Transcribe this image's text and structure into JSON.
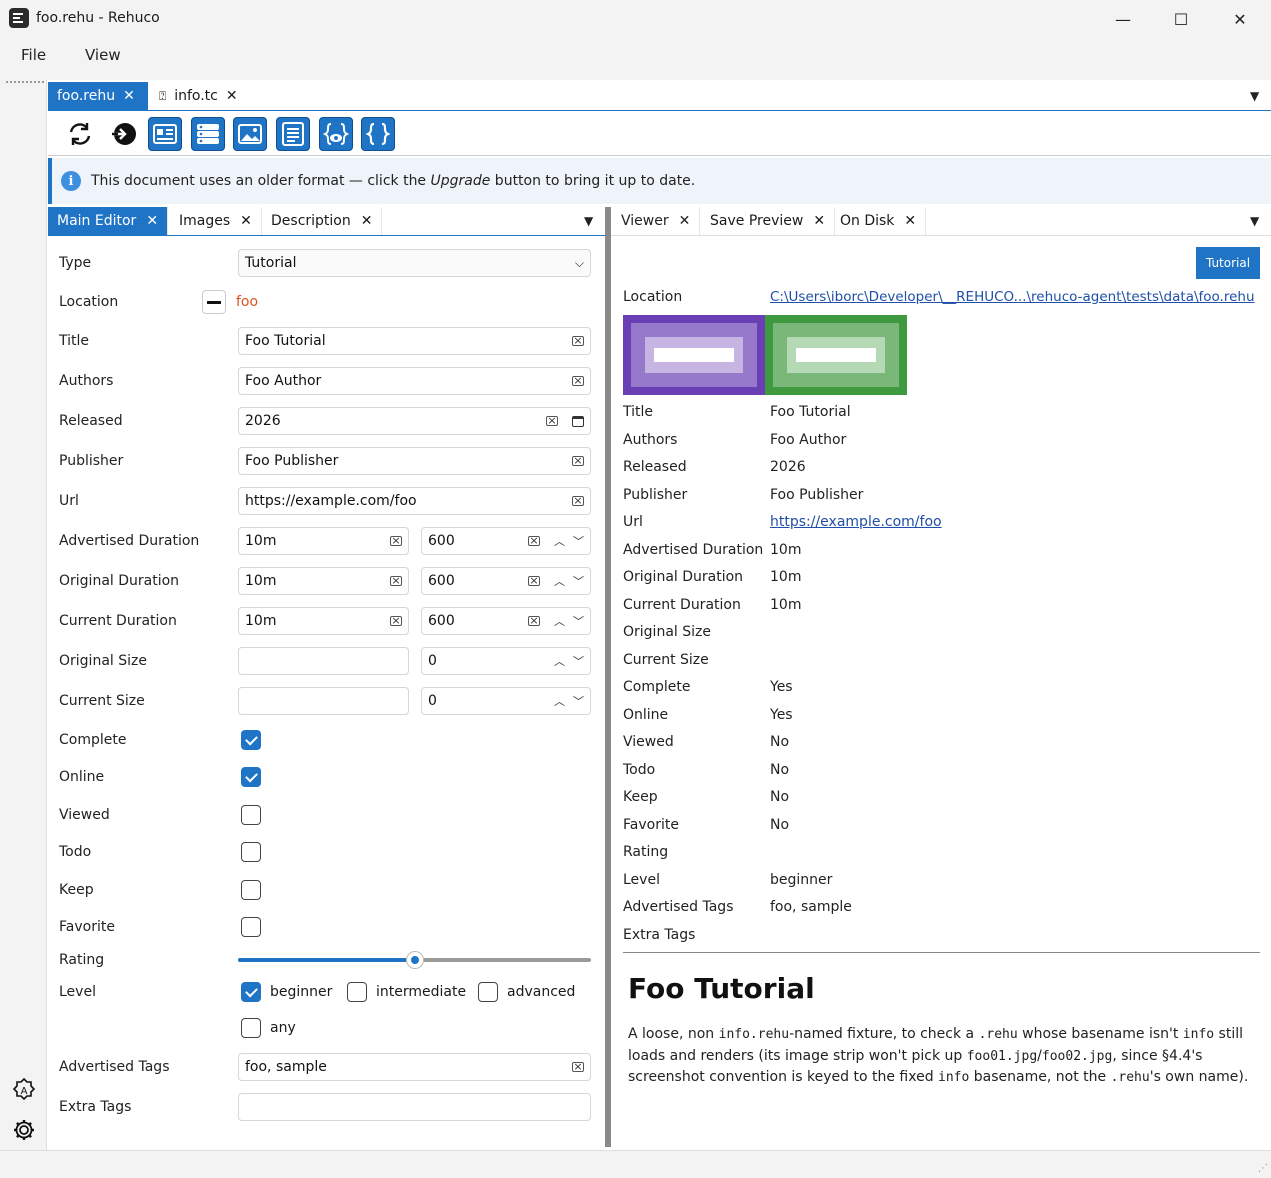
{
  "window": {
    "title": "foo.rehu - Rehuco",
    "min": "—",
    "max": "☐",
    "close": "✕"
  },
  "menu": [
    "File",
    "View"
  ],
  "doc_tabs": [
    {
      "label": "foo.rehu",
      "active": true
    },
    {
      "label": "info.tc",
      "active": false
    }
  ],
  "toolbar": {
    "icons": [
      "refresh-icon",
      "upgrade-icon",
      "card-view-icon",
      "list-view-icon",
      "image-view-icon",
      "text-view-icon",
      "json-preview-icon",
      "json-icon"
    ]
  },
  "info_bar": {
    "before": "This document uses an older format — click the ",
    "emph": "Upgrade",
    "after": " button to bring it up to date."
  },
  "left_tabs": [
    {
      "label": "Main Editor",
      "active": true
    },
    {
      "label": "Images"
    },
    {
      "label": "Description"
    }
  ],
  "right_tabs": [
    {
      "label": "Viewer",
      "active": true
    },
    {
      "label": "Save Preview"
    },
    {
      "label": "On Disk"
    }
  ],
  "editor": {
    "type_label": "Type",
    "type_value": "Tutorial",
    "location_label": "Location",
    "location_value": "foo",
    "title_label": "Title",
    "title_value": "Foo Tutorial",
    "authors_label": "Authors",
    "authors_value": "Foo Author",
    "released_label": "Released",
    "released_value": "2026",
    "publisher_label": "Publisher",
    "publisher_value": "Foo Publisher",
    "url_label": "Url",
    "url_value": "https://example.com/foo",
    "adv_dur_label": "Advertised Duration",
    "adv_dur_text": "10m",
    "adv_dur_num": "600",
    "orig_dur_label": "Original Duration",
    "orig_dur_text": "10m",
    "orig_dur_num": "600",
    "cur_dur_label": "Current Duration",
    "cur_dur_text": "10m",
    "cur_dur_num": "600",
    "orig_size_label": "Original Size",
    "orig_size_text": "",
    "orig_size_num": "0",
    "cur_size_label": "Current Size",
    "cur_size_text": "",
    "cur_size_num": "0",
    "complete_label": "Complete",
    "complete": true,
    "online_label": "Online",
    "online": true,
    "viewed_label": "Viewed",
    "viewed": false,
    "todo_label": "Todo",
    "todo": false,
    "keep_label": "Keep",
    "keep": false,
    "favorite_label": "Favorite",
    "favorite": false,
    "rating_label": "Rating",
    "rating_fraction": 0.5,
    "level_label": "Level",
    "levels": [
      {
        "label": "beginner",
        "checked": true
      },
      {
        "label": "intermediate",
        "checked": false
      },
      {
        "label": "advanced",
        "checked": false
      },
      {
        "label": "any",
        "checked": false
      }
    ],
    "adv_tags_label": "Advertised Tags",
    "adv_tags_value": "foo, sample",
    "extra_tags_label": "Extra Tags",
    "extra_tags_value": ""
  },
  "viewer": {
    "badge": "Tutorial",
    "location_label": "Location",
    "location_value": "C:\\Users\\iborc\\Developer\\__REHUCO...\\rehuco-agent\\tests\\data\\foo.rehu",
    "rows": [
      {
        "label": "Title",
        "value": "Foo Tutorial"
      },
      {
        "label": "Authors",
        "value": "Foo Author"
      },
      {
        "label": "Released",
        "value": "2026"
      },
      {
        "label": "Publisher",
        "value": "Foo Publisher"
      },
      {
        "label": "Url",
        "value": "https://example.com/foo",
        "link": true
      },
      {
        "label": "Advertised Duration",
        "value": "10m"
      },
      {
        "label": "Original Duration",
        "value": "10m"
      },
      {
        "label": "Current Duration",
        "value": "10m"
      },
      {
        "label": "Original Size",
        "value": ""
      },
      {
        "label": "Current Size",
        "value": ""
      },
      {
        "label": "Complete",
        "value": "Yes"
      },
      {
        "label": "Online",
        "value": "Yes"
      },
      {
        "label": "Viewed",
        "value": "No"
      },
      {
        "label": "Todo",
        "value": "No"
      },
      {
        "label": "Keep",
        "value": "No"
      },
      {
        "label": "Favorite",
        "value": "No"
      },
      {
        "label": "Rating",
        "value": ""
      },
      {
        "label": "Level",
        "value": "beginner"
      },
      {
        "label": "Advertised Tags",
        "value": "foo, sample"
      },
      {
        "label": "Extra Tags",
        "value": ""
      }
    ],
    "thumb_colors": [
      "#6a3fb5",
      "#3f9a3f"
    ],
    "md_title": "Foo Tutorial",
    "md_segments": [
      {
        "t": "A loose, non "
      },
      {
        "c": "info.rehu"
      },
      {
        "t": "-named fixture, to check a "
      },
      {
        "c": ".rehu"
      },
      {
        "t": " whose basename isn't "
      },
      {
        "c": "info"
      },
      {
        "t": " still loads and renders (its image strip won't pick up "
      },
      {
        "c": "foo01.jpg"
      },
      {
        "t": "/"
      },
      {
        "c": "foo02.jpg"
      },
      {
        "t": ", since §4.4's screenshot convention is keyed to the fixed "
      },
      {
        "c": "info"
      },
      {
        "t": " basename, not the "
      },
      {
        "c": ".rehu"
      },
      {
        "t": "'s own name)."
      }
    ]
  },
  "accent": "#1f74c6"
}
